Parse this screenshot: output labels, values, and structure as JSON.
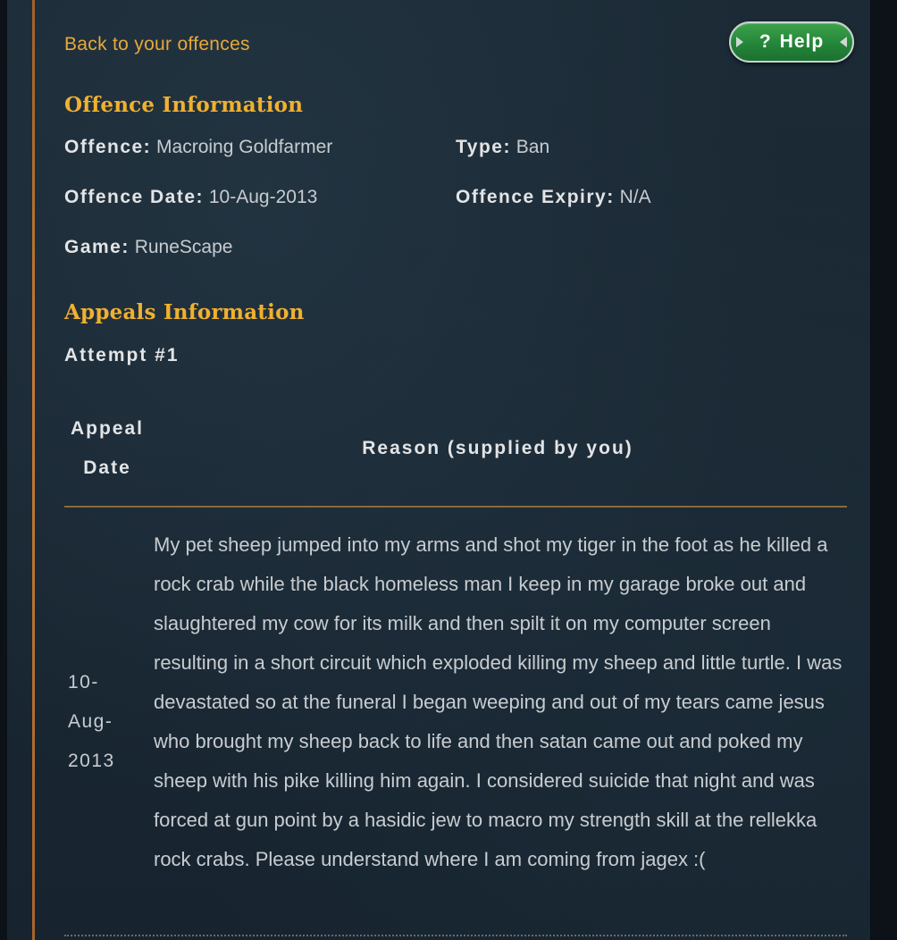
{
  "nav": {
    "back_label": "Back to your offences",
    "help_label": "Help",
    "help_glyph": "?"
  },
  "offence": {
    "title": "Offence Information",
    "offence_label": "Offence:",
    "offence_value": "Macroing Goldfarmer",
    "type_label": "Type:",
    "type_value": "Ban",
    "date_label": "Offence Date:",
    "date_value": "10-Aug-2013",
    "expiry_label": "Offence Expiry:",
    "expiry_value": "N/A",
    "game_label": "Game:",
    "game_value": "RuneScape"
  },
  "appeals": {
    "title": "Appeals Information",
    "attempt_label": "Attempt #1",
    "columns": {
      "date_line1": "Appeal",
      "date_line2": "Date",
      "reason": "Reason (supplied by you)"
    },
    "rows": [
      {
        "date_parts": [
          "10-",
          "Aug-",
          "2013"
        ],
        "reason": "My pet sheep jumped into my arms and shot my tiger in the foot as he killed a rock crab while the black homeless man I keep in my garage broke out and slaughtered my cow for its milk and then spilt it on my computer screen resulting in a short circuit which exploded killing my sheep and little turtle. I was devastated so at the funeral I began weeping and out of my tears came jesus who brought my sheep back to life and then satan came out and poked my sheep with his pike killing him again. I considered suicide that night and was forced at gun point by a hasidic jew to macro my strength skill at the rellekka rock crabs. Please understand where I am coming from jagex :("
      }
    ]
  },
  "colors": {
    "accent_gold": "#f0b030",
    "link_orange": "#e8a83a",
    "help_green": "#23863a",
    "panel_bg": "#1a2833",
    "text": "#c8ccd0"
  }
}
